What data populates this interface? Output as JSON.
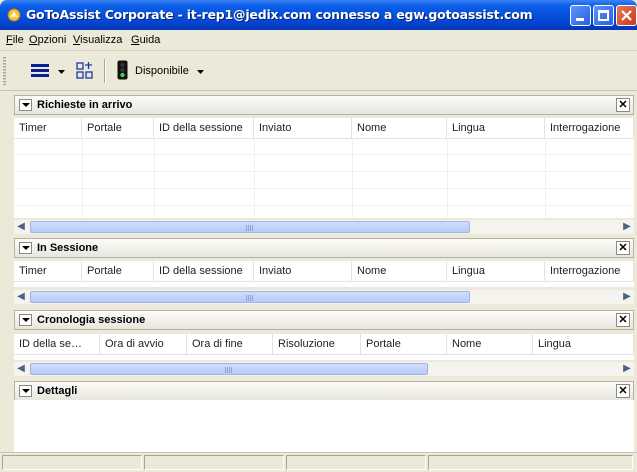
{
  "window": {
    "title": "GoToAssist Corporate - it-rep1@jedix.com connesso a egw.gotoassist.com"
  },
  "menu": [
    {
      "label": "File",
      "mnemonic": "F",
      "rest": "ile"
    },
    {
      "label": "Opzioni",
      "mnemonic": "O",
      "rest": "pzioni"
    },
    {
      "label": "Visualizza",
      "mnemonic": "V",
      "rest": "isualizza"
    },
    {
      "label": "Guida",
      "mnemonic": "G",
      "rest": "uida"
    }
  ],
  "toolbar": {
    "status_label": "Disponibile"
  },
  "panels": {
    "incoming": {
      "title": "Richieste in arrivo",
      "columns": [
        "Timer",
        "Portale",
        "ID della sessione",
        "Inviato",
        "Nome",
        "Lingua",
        "Interrogazione"
      ]
    },
    "in_session": {
      "title": "In Sessione",
      "columns": [
        "Timer",
        "Portale",
        "ID della sessione",
        "Inviato",
        "Nome",
        "Lingua",
        "Interrogazione"
      ]
    },
    "history": {
      "title": "Cronologia sessione",
      "columns": [
        "ID della se…",
        "Ora di avvio",
        "Ora di fine",
        "Risoluzione",
        "Portale",
        "Nome",
        "Lingua"
      ]
    },
    "details": {
      "title": "Dettagli"
    }
  },
  "colors": {
    "titlebar": "#0548d6",
    "chrome": "#ece9d8",
    "scroll_thumb": "#b8cbf5"
  }
}
